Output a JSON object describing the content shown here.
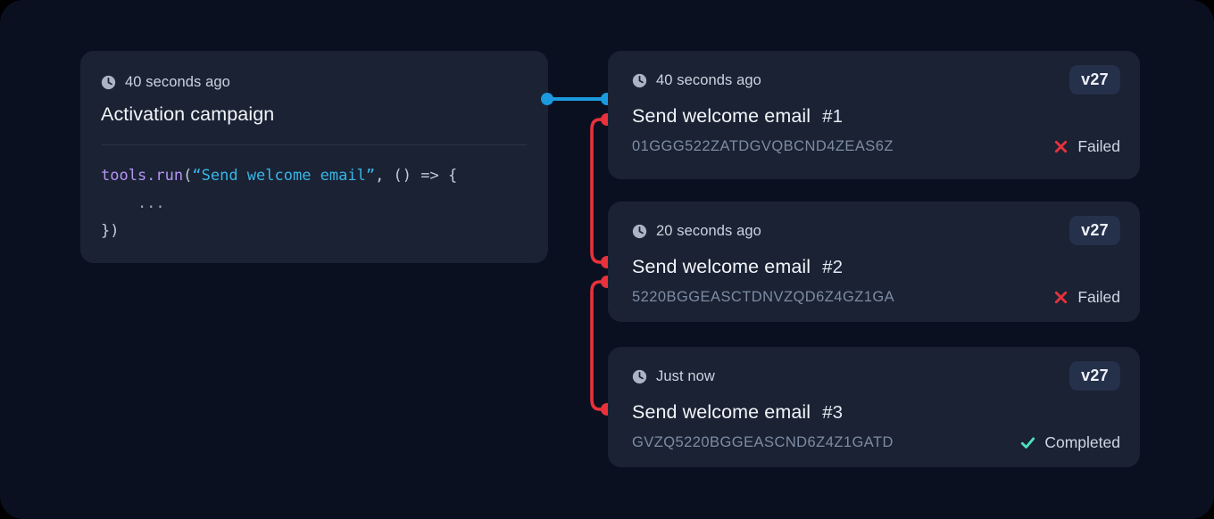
{
  "theme": {
    "background": "#0b1020",
    "card_background": "#1a2233",
    "badge_background": "#25304a",
    "accent_blue": "#1b9ae0",
    "accent_red": "#e8313b",
    "accent_green": "#4fe0bd",
    "text_primary": "#f2f5fa",
    "text_muted": "#7d8ca3"
  },
  "source_card": {
    "timestamp": "40 seconds ago",
    "clock_icon": "clock-icon",
    "title": "Activation campaign",
    "code": {
      "line1_fn": "tools.run",
      "line1_open": "(",
      "line1_string": "“Send welcome email”",
      "line1_tail": ", () => {",
      "line2": "    ...",
      "line3": "})"
    }
  },
  "runs": [
    {
      "timestamp": "40 seconds ago",
      "clock_icon": "clock-icon",
      "version": "v27",
      "title": "Send welcome email",
      "index": "#1",
      "id": "01GGG522ZATDGVQBCND4ZEAS6Z",
      "status": "Failed",
      "status_icon": "x-mark-icon"
    },
    {
      "timestamp": "20 seconds ago",
      "clock_icon": "clock-icon",
      "version": "v27",
      "title": "Send welcome email",
      "index": "#2",
      "id": "5220BGGEASCTDNVZQD6Z4GZ1GA",
      "status": "Failed",
      "status_icon": "x-mark-icon"
    },
    {
      "timestamp": "Just now",
      "clock_icon": "clock-icon",
      "version": "v27",
      "title": "Send welcome email",
      "index": "#3",
      "id": "GVZQ5220BGGEASCND6Z4Z1GATD",
      "status": "Completed",
      "status_icon": "check-mark-icon"
    }
  ],
  "connectors": [
    {
      "name": "source-to-run-1",
      "style": "straight",
      "color": "#1b9ae0"
    },
    {
      "name": "run-1-to-run-2",
      "style": "curved",
      "color": "#e8313b"
    },
    {
      "name": "run-2-to-run-3",
      "style": "curved",
      "color": "#e8313b"
    }
  ]
}
